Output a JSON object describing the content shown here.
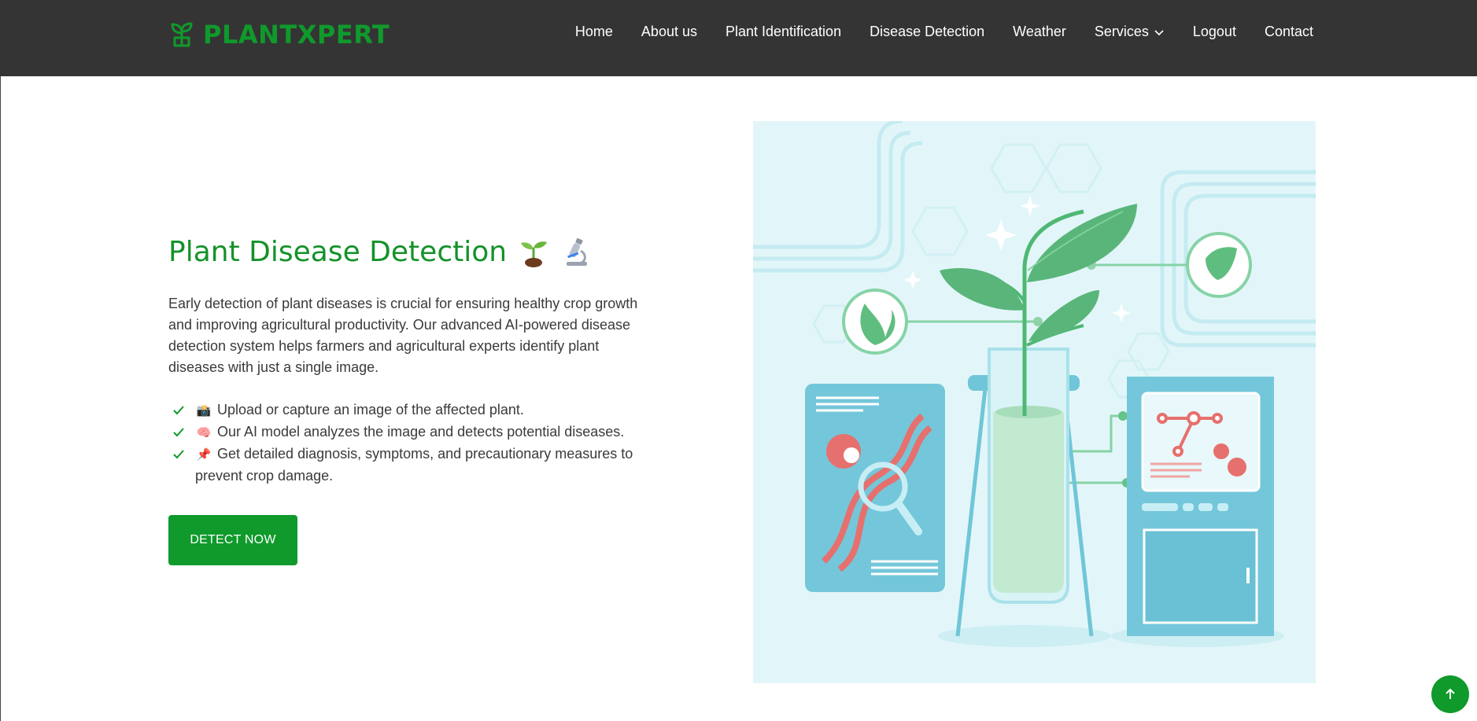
{
  "brand": {
    "name": "PLANTXPERT",
    "icon": "sprout-icon",
    "color": "#0f9a2b"
  },
  "nav": {
    "items": [
      {
        "label": "Home"
      },
      {
        "label": "About us"
      },
      {
        "label": "Plant Identification"
      },
      {
        "label": "Disease Detection"
      },
      {
        "label": "Weather"
      },
      {
        "label": "Services",
        "icon": "chevron-down-icon"
      },
      {
        "label": "Logout"
      },
      {
        "label": "Contact"
      }
    ]
  },
  "hero": {
    "title": "Plant Disease Detection",
    "title_icons": [
      "seedling-icon",
      "microscope-icon"
    ],
    "description": "Early detection of plant diseases is crucial for ensuring healthy crop growth and improving agricultural productivity. Our advanced AI-powered disease detection system helps farmers and agricultural experts identify plant diseases with just a single image.",
    "features": [
      {
        "icon": "camera-icon",
        "text": "Upload or capture an image of the affected plant."
      },
      {
        "icon": "brain-icon",
        "text": "Our AI model analyzes the image and detects potential diseases."
      },
      {
        "icon": "pushpin-icon",
        "text": "Get detailed diagnosis, symptoms, and precautionary measures to prevent crop damage."
      }
    ],
    "cta_label": "DETECT NOW"
  },
  "illustration": {
    "subject": "lab-plant-illustration",
    "background": "#e2f6f9"
  },
  "scroll_top": {
    "icon": "arrow-up-icon"
  },
  "colors": {
    "navbar_bg": "#343434",
    "accent": "#0f9a2b",
    "text": "#3a3a3a"
  }
}
